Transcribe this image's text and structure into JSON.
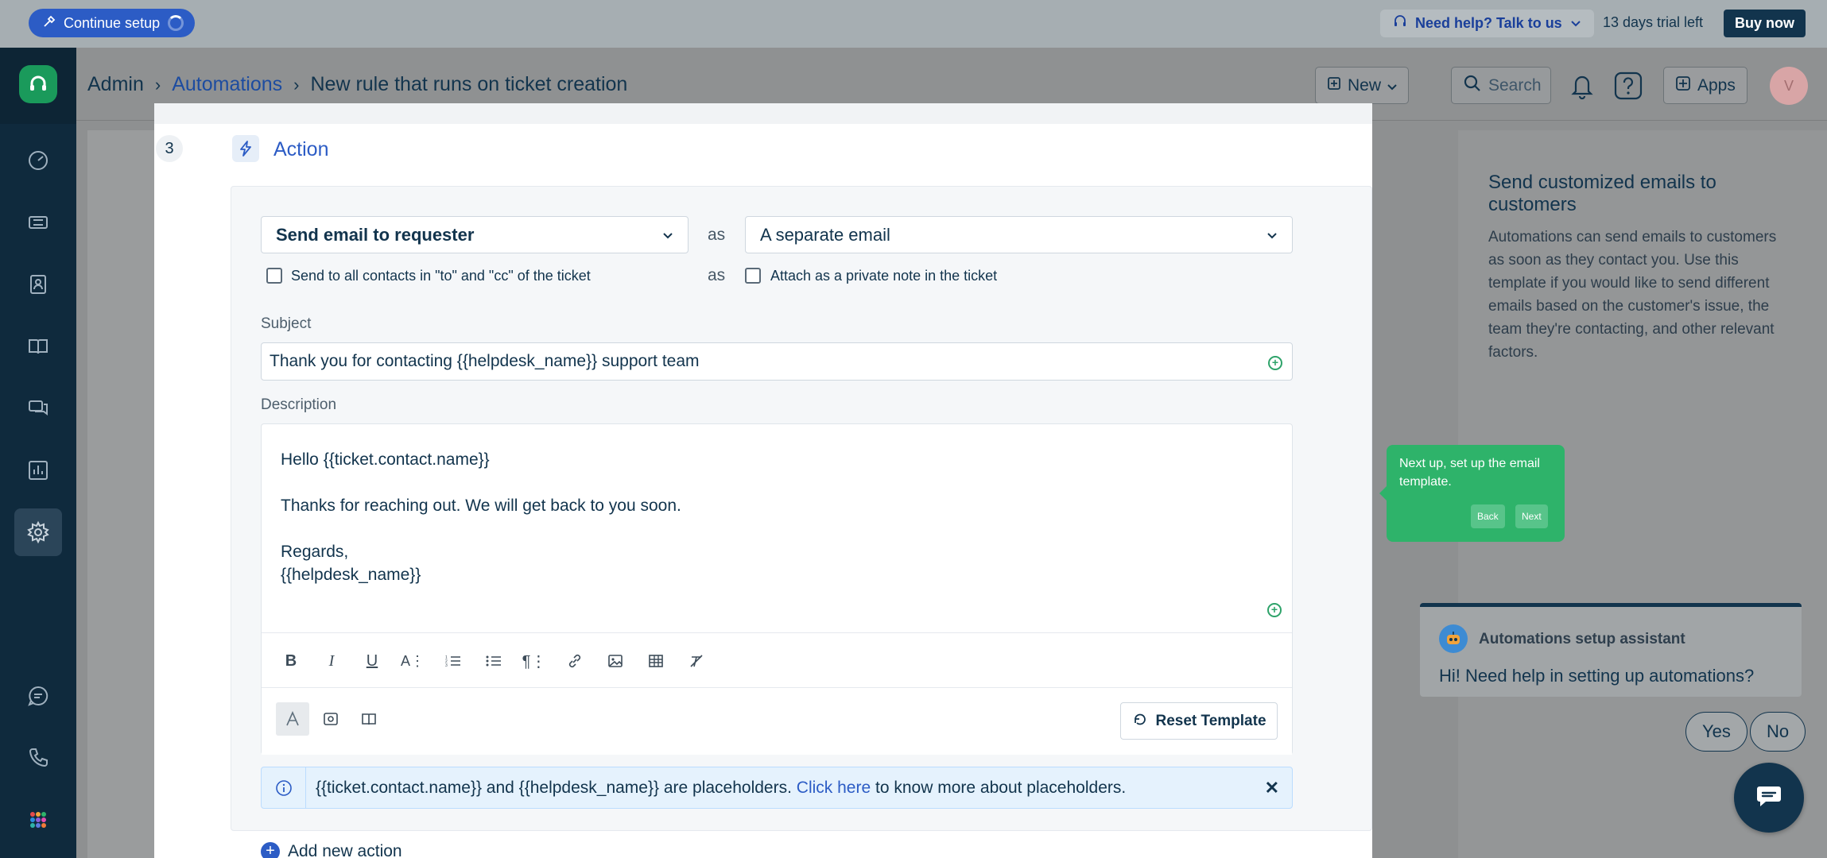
{
  "topbar": {
    "continue_setup": "Continue setup",
    "help": "Need help? Talk to us",
    "trial": "13 days trial left",
    "buy_now": "Buy now"
  },
  "header": {
    "breadcrumb": [
      "Admin",
      "Automations",
      "New rule that runs on ticket creation"
    ],
    "new_button": "New",
    "search_placeholder": "Search",
    "apps_button": "Apps",
    "avatar_initial": "V"
  },
  "action": {
    "step_number": "3",
    "title": "Action",
    "action_select": "Send email to requester",
    "as_label": "as",
    "mode_select": "A separate email",
    "checkbox_contacts": "Send to all contacts in \"to\" and \"cc\" of the ticket",
    "checkbox_private_note": "Attach as a private note in the ticket",
    "subject_label": "Subject",
    "subject_value": "Thank you for contacting {{helpdesk_name}} support team",
    "description_label": "Description",
    "description_lines": [
      "Hello {{ticket.contact.name}}",
      "",
      "Thanks for reaching out. We will get back to you soon.",
      "",
      "Regards,",
      "{{helpdesk_name}}"
    ],
    "reset_template": "Reset Template",
    "info_text": "{{ticket.contact.name}} and {{helpdesk_name}} are placeholders.",
    "info_link": "Click here",
    "info_suffix": "to know more about placeholders.",
    "add_new_action": "Add new action"
  },
  "side_panel": {
    "title": "Send customized emails to customers",
    "body": "Automations can send emails to customers as soon as they contact you. Use this template if you would like to send different emails based on the customer's issue, the team they're contacting, and other relevant factors."
  },
  "tooltip": {
    "text": "Next up, set up the email template.",
    "back": "Back",
    "next": "Next"
  },
  "assistant": {
    "name": "Automations setup assistant",
    "message": "Hi! Need help in setting up automations?",
    "yes": "Yes",
    "no": "No"
  },
  "colors": {
    "primary_blue": "#2c5cc5",
    "nav_dark": "#0f2a3d",
    "brand_green": "#1a9a5b",
    "tooltip_green": "#2eb36a"
  }
}
